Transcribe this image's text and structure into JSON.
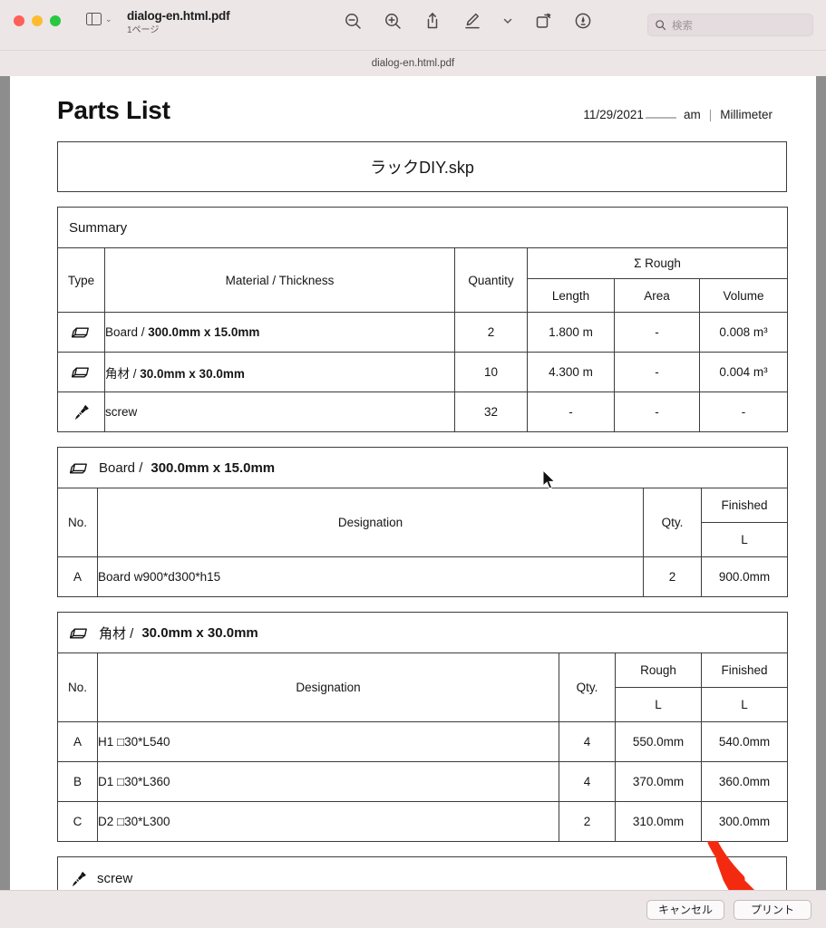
{
  "window": {
    "toolbar_title": "dialog-en.html.pdf",
    "toolbar_subtitle": "1ページ",
    "window_subtitle": "dialog-en.html.pdf",
    "search_placeholder": "検索",
    "traffic_lights": [
      "close-red",
      "minimize-yellow",
      "zoom-green"
    ],
    "tool_icons": [
      "zoom-out-icon",
      "zoom-in-icon",
      "share-icon",
      "markup-pen-icon",
      "chevron-down-icon",
      "rotate-icon",
      "annotate-icon"
    ]
  },
  "document": {
    "title": "Parts List",
    "date": "11/29/2021",
    "time_blank": "",
    "ampm": "am",
    "separator": "|",
    "unit": "Millimeter",
    "filename": "ラックDIY.skp"
  },
  "summary": {
    "caption": "Summary",
    "headers": {
      "type": "Type",
      "material": "Material / Thickness",
      "quantity": "Quantity",
      "group": "Σ Rough",
      "length": "Length",
      "area": "Area",
      "volume": "Volume"
    },
    "rows": [
      {
        "icon": "board-icon",
        "material_plain": "Board / ",
        "material_bold": "300.0mm x 15.0mm",
        "quantity": "2",
        "length": "1.800 m",
        "area": "-",
        "volume": "0.008 m³"
      },
      {
        "icon": "board-icon",
        "material_plain": "角材 / ",
        "material_bold": "30.0mm x 30.0mm",
        "quantity": "10",
        "length": "4.300 m",
        "area": "-",
        "volume": "0.004 m³"
      },
      {
        "icon": "screw-icon",
        "material_plain": "screw",
        "material_bold": "",
        "quantity": "32",
        "length": "-",
        "area": "-",
        "volume": "-"
      }
    ]
  },
  "board_section": {
    "caption_plain": "Board / ",
    "caption_bold": "300.0mm x 15.0mm",
    "caption_icon": "board-icon",
    "headers": {
      "no": "No.",
      "designation": "Designation",
      "qty": "Qty.",
      "finished": "Finished",
      "finished_sub": "L"
    },
    "rows": [
      {
        "no": "A",
        "designation": "Board w900*d300*h15",
        "qty": "2",
        "finished": "900.0mm"
      }
    ]
  },
  "kakuzai_section": {
    "caption_plain": "角材 / ",
    "caption_bold": "30.0mm x 30.0mm",
    "caption_icon": "board-icon",
    "headers": {
      "no": "No.",
      "designation": "Designation",
      "qty": "Qty.",
      "rough": "Rough",
      "rough_sub": "L",
      "finished": "Finished",
      "finished_sub": "L"
    },
    "rows": [
      {
        "no": "A",
        "designation": "H1 □30*L540",
        "qty": "4",
        "rough": "550.0mm",
        "finished": "540.0mm"
      },
      {
        "no": "B",
        "designation": "D1 □30*L360",
        "qty": "4",
        "rough": "370.0mm",
        "finished": "360.0mm"
      },
      {
        "no": "C",
        "designation": "D2 □30*L300",
        "qty": "2",
        "rough": "310.0mm",
        "finished": "300.0mm"
      }
    ]
  },
  "screw_section": {
    "caption": "screw",
    "caption_icon": "screw-icon"
  },
  "dialog": {
    "cancel_label": "キャンセル",
    "print_label": "プリント"
  },
  "annotation": {
    "arrow": "red-arrow-pointing-to-print-button",
    "color": "#f32a10"
  },
  "colors": {
    "toolbar_bg": "#ece6e7",
    "page_bg": "#ffffff",
    "window_bg": "#8d8d8d",
    "rough_value": "#e8231c",
    "row_letter": "#e02020"
  }
}
